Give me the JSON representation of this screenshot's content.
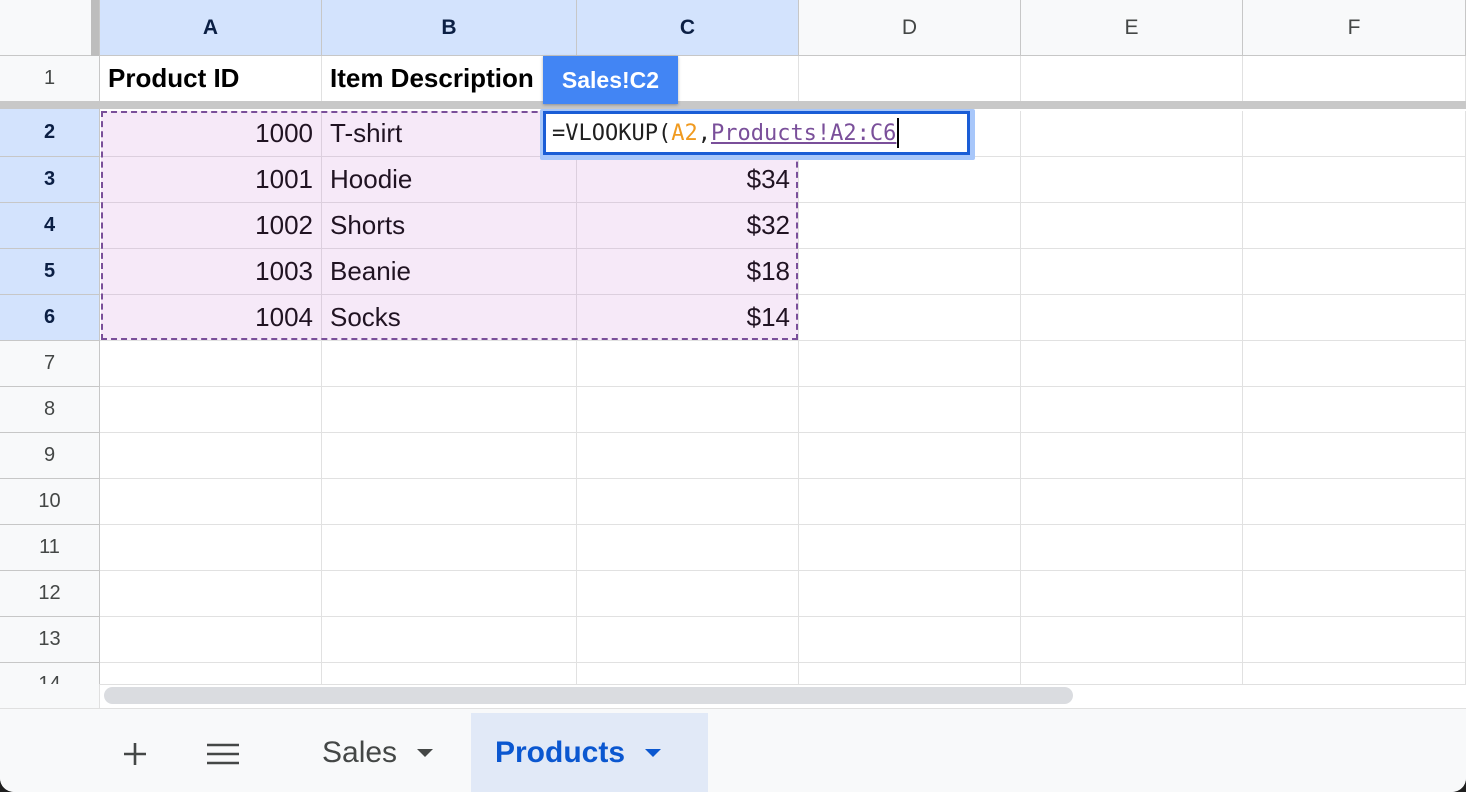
{
  "columns": [
    "A",
    "B",
    "C",
    "D",
    "E",
    "F"
  ],
  "row_numbers": [
    "1",
    "2",
    "3",
    "4",
    "5",
    "6",
    "7",
    "8",
    "9",
    "10",
    "11",
    "12",
    "13",
    "14"
  ],
  "header_row": [
    "Product ID",
    "Item Description"
  ],
  "rows": [
    {
      "id": "1000",
      "item": "T-shirt",
      "price": ""
    },
    {
      "id": "1001",
      "item": "Hoodie",
      "price": "$34"
    },
    {
      "id": "1002",
      "item": "Shorts",
      "price": "$32"
    },
    {
      "id": "1003",
      "item": "Beanie",
      "price": "$18"
    },
    {
      "id": "1004",
      "item": "Socks",
      "price": "$14"
    }
  ],
  "reference_chip": "Sales!C2",
  "formula": {
    "prefix": "=VLOOKUP(",
    "arg1": "A2",
    "sep": ",",
    "arg2": "Products!A2:C6"
  },
  "sheet_tabs": [
    {
      "label": "Sales",
      "active": false
    },
    {
      "label": "Products",
      "active": true
    }
  ],
  "colors": {
    "selection_header": "#d3e3fd",
    "range_border": "#7a4f9a",
    "ref_chip": "#4285f4",
    "active_tab_text": "#0b57d0",
    "formula_arg1": "#f09a1f"
  },
  "icons": {
    "add_sheet": "plus-icon",
    "all_sheets": "menu-icon",
    "tab_menu": "caret-down-icon"
  }
}
